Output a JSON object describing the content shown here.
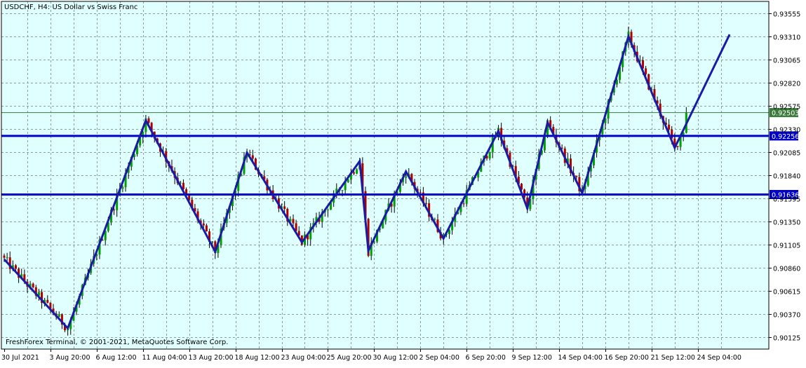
{
  "header": {
    "symbol": "USDCHF,",
    "timeframe": "H4:",
    "description": "US Dollar vs Swiss Franc"
  },
  "footer": {
    "copyright": "FreshForex Terminal, © 2001-2021, MetaQuotes Software Corp."
  },
  "colors": {
    "background": "#e0ffff",
    "grid": "#8aa0a0",
    "candle_up": "#00a000",
    "candle_down": "#b00000",
    "wick": "#000000",
    "trend": "#1a1aa8",
    "level_line": "#0000c8",
    "price_line": "#3a7a3a"
  },
  "chart_data": {
    "type": "candlestick",
    "symbol": "USDCHF",
    "timeframe": "H4",
    "ylim": [
      0.9,
      0.9368
    ],
    "price_ticks": [
      "0.93555",
      "0.93310",
      "0.93065",
      "0.92820",
      "0.92575",
      "0.92330",
      "0.92085",
      "0.91840",
      "0.91595",
      "0.91350",
      "0.91105",
      "0.90860",
      "0.90615",
      "0.90370",
      "0.90125"
    ],
    "time_ticks": [
      "30 Jul 2021",
      "3 Aug 20:00",
      "6 Aug 12:00",
      "11 Aug 04:00",
      "13 Aug 20:00",
      "18 Aug 12:00",
      "23 Aug 04:00",
      "25 Aug 20:00",
      "30 Aug 12:00",
      "2 Sep 04:00",
      "6 Sep 20:00",
      "9 Sep 12:00",
      "14 Sep 04:00",
      "16 Sep 20:00",
      "21 Sep 12:00",
      "24 Sep 04:00"
    ],
    "current_price": {
      "label": "0.92503",
      "value": 0.92503
    },
    "horizontal_levels": [
      {
        "label": "0.92256",
        "value": 0.92256
      },
      {
        "label": "0.91636",
        "value": 0.91636
      }
    ],
    "zigzag": [
      {
        "bar": 0,
        "price": 0.9095
      },
      {
        "bar": 22,
        "price": 0.9022
      },
      {
        "bar": 49,
        "price": 0.9242
      },
      {
        "bar": 73,
        "price": 0.9103
      },
      {
        "bar": 84,
        "price": 0.9208
      },
      {
        "bar": 103,
        "price": 0.9113
      },
      {
        "bar": 123,
        "price": 0.9199
      },
      {
        "bar": 126,
        "price": 0.9104
      },
      {
        "bar": 139,
        "price": 0.9188
      },
      {
        "bar": 152,
        "price": 0.9117
      },
      {
        "bar": 171,
        "price": 0.9231
      },
      {
        "bar": 181,
        "price": 0.9149
      },
      {
        "bar": 188,
        "price": 0.924
      },
      {
        "bar": 200,
        "price": 0.9165
      },
      {
        "bar": 216,
        "price": 0.9331
      },
      {
        "bar": 232,
        "price": 0.9213
      },
      {
        "bar": 251,
        "price": 0.9333
      }
    ]
  }
}
